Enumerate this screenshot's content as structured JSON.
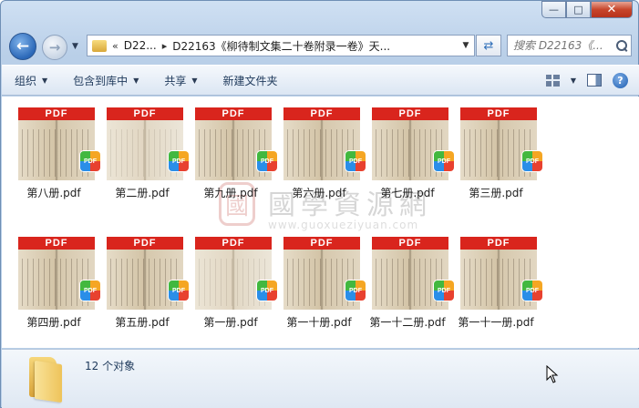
{
  "window": {
    "minimize_glyph": "—",
    "maximize_glyph": "□",
    "close_glyph": "✕"
  },
  "nav": {
    "back_glyph": "←",
    "forward_glyph": "→",
    "history_drop_glyph": "▼",
    "breadcrumb": {
      "overflow": "«",
      "items": [
        "D22...",
        "D22163《柳待制文集二十卷附录一卷》天..."
      ],
      "separator": "▸"
    },
    "address_drop_glyph": "▼",
    "refresh_glyph": "⇄",
    "search_placeholder": "搜索 D22163《..."
  },
  "toolbar": {
    "organize": "组织",
    "include_in_library": "包含到库中",
    "share": "共享",
    "new_folder": "新建文件夹",
    "dropdown_glyph": "▼",
    "help_glyph": "?"
  },
  "watermark": {
    "seal_char": "國",
    "site_cn": "國學資源網",
    "site_url": "www.guoxueziyuan.com"
  },
  "files": [
    {
      "name": "第八册.pdf",
      "band": "PDF",
      "badge": "PDF",
      "style": "dark"
    },
    {
      "name": "第二册.pdf",
      "band": "PDF",
      "badge": "PDF",
      "style": "light"
    },
    {
      "name": "第九册.pdf",
      "band": "PDF",
      "badge": "PDF",
      "style": "dark"
    },
    {
      "name": "第六册.pdf",
      "band": "PDF",
      "badge": "PDF",
      "style": "dark"
    },
    {
      "name": "第七册.pdf",
      "band": "PDF",
      "badge": "PDF",
      "style": "dark"
    },
    {
      "name": "第三册.pdf",
      "band": "PDF",
      "badge": "PDF",
      "style": "dark"
    },
    {
      "name": "第四册.pdf",
      "band": "PDF",
      "badge": "PDF",
      "style": "dark"
    },
    {
      "name": "第五册.pdf",
      "band": "PDF",
      "badge": "PDF",
      "style": "dark"
    },
    {
      "name": "第一册.pdf",
      "band": "PDF",
      "badge": "PDF",
      "style": "light"
    },
    {
      "name": "第一十册.pdf",
      "band": "PDF",
      "badge": "PDF",
      "style": "dark"
    },
    {
      "name": "第一十二册.pdf",
      "band": "PDF",
      "badge": "PDF",
      "style": "dark"
    },
    {
      "name": "第一十一册.pdf",
      "band": "PDF",
      "badge": "PDF",
      "style": "dark"
    }
  ],
  "status": {
    "count_text": "12 个对象"
  }
}
